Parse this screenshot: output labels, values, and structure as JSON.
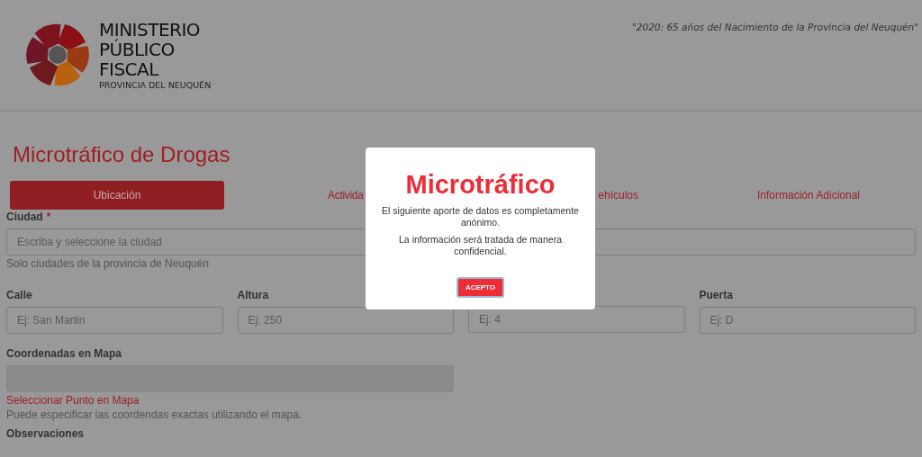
{
  "header": {
    "logo": {
      "lines": [
        "MINISTERIO",
        "PÚBLICO",
        "FISCAL"
      ],
      "subtitle": "PROVINCIA DEL NEUQUÉN"
    },
    "motto": "\"2020: 65 años del Nacimiento de la Provincia del Neuquén\""
  },
  "page_title": "Microtráfico de Drogas",
  "tabs": [
    {
      "label": "Ubicación",
      "selected": true
    },
    {
      "label": "Activida",
      "selected": false
    },
    {
      "label": "ehículos",
      "selected": false
    },
    {
      "label": "Información Adicional",
      "selected": false
    }
  ],
  "form": {
    "rows": [
      {
        "fields": [
          {
            "kind": "full",
            "label": "Ciudad",
            "required_mark": "*",
            "placeholder": "Escriba y seleccione la ciudad",
            "help": "Solo ciudades de la provincia de Neuquén"
          }
        ]
      },
      {
        "fields": [
          {
            "kind": "quarter",
            "label": "Calle",
            "placeholder": "Ej: San Martin"
          },
          {
            "kind": "quarter",
            "label": "Altura",
            "placeholder": "Ej: 250"
          },
          {
            "kind": "quarter",
            "placeholder": "Ej: 4"
          },
          {
            "kind": "quarter",
            "label": "Puerta",
            "placeholder": "Ej: D"
          }
        ]
      },
      {
        "fields": [
          {
            "kind": "half",
            "label": "Coordenadas en Mapa",
            "disabled": true,
            "link": "Seleccionar Punto en Mapa",
            "help": "Puede especificar las coordendas exactas utilizando el mapa."
          }
        ]
      },
      {
        "fields": [
          {
            "kind": "label",
            "label": "Observaciones"
          }
        ]
      }
    ]
  },
  "modal": {
    "title": "Microtráfico",
    "paragraphs": [
      "El siguiente aporte de datos es completamente anónimo.",
      "La información será tratada de manera confidencial."
    ],
    "button": "ACEPTO"
  }
}
